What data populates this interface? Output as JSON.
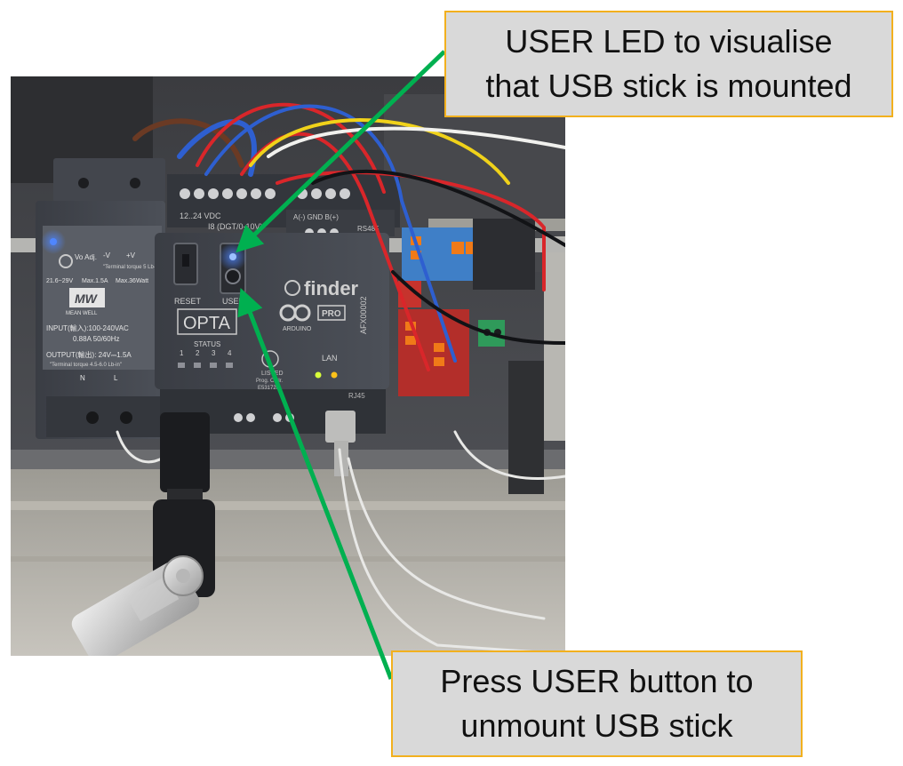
{
  "callouts": {
    "led": {
      "line1": "USER LED to visualise",
      "line2": "that USB stick is mounted"
    },
    "button": {
      "line1": "Press USER button to",
      "line2": "unmount USB stick"
    }
  },
  "device": {
    "power_supply": {
      "brand": "MEAN WELL",
      "vo_adj": "Vo Adj.",
      "minus_v": "-V",
      "plus_v": "+V",
      "terminal_torque": "\"Terminal torque 5 Lb-in\"",
      "range": "21.6~29V",
      "max_current": "Max.1.5A",
      "max_power": "Max.36Watt",
      "input_1": "INPUT(輸入):100-240VAC",
      "input_2": "0.88A  50/60Hz",
      "output": "OUTPUT(輸出): 24V⎓1.5A",
      "output_torque": "\"Terminal torque 4.5-6.0 Lb-in\"",
      "n_label": "N",
      "l_label": "L"
    },
    "opta": {
      "supply": "12..24 VDC",
      "inputs": "I8 (DGT/0-10V)",
      "rs485_pins": "A(-) GND B(+)",
      "rs485": "RS485",
      "reset": "RESET",
      "user": "USER",
      "opta_label": "OPTA",
      "status": "STATUS",
      "status_numbers": [
        "1",
        "2",
        "3",
        "4"
      ],
      "finder": "finder",
      "pro": "PRO",
      "arduino": "ARDUINO",
      "model": "AFX00002",
      "lan": "LAN",
      "rj45": "RJ45",
      "ul": "LISTED",
      "ul_sub": "Prog. Cntlr.",
      "ul_code": "E531726"
    }
  },
  "colors": {
    "callout_fill": "#d9d9d9",
    "callout_border": "#f2b01e",
    "arrow": "#00b050",
    "led_blue": "#2a6bff"
  }
}
